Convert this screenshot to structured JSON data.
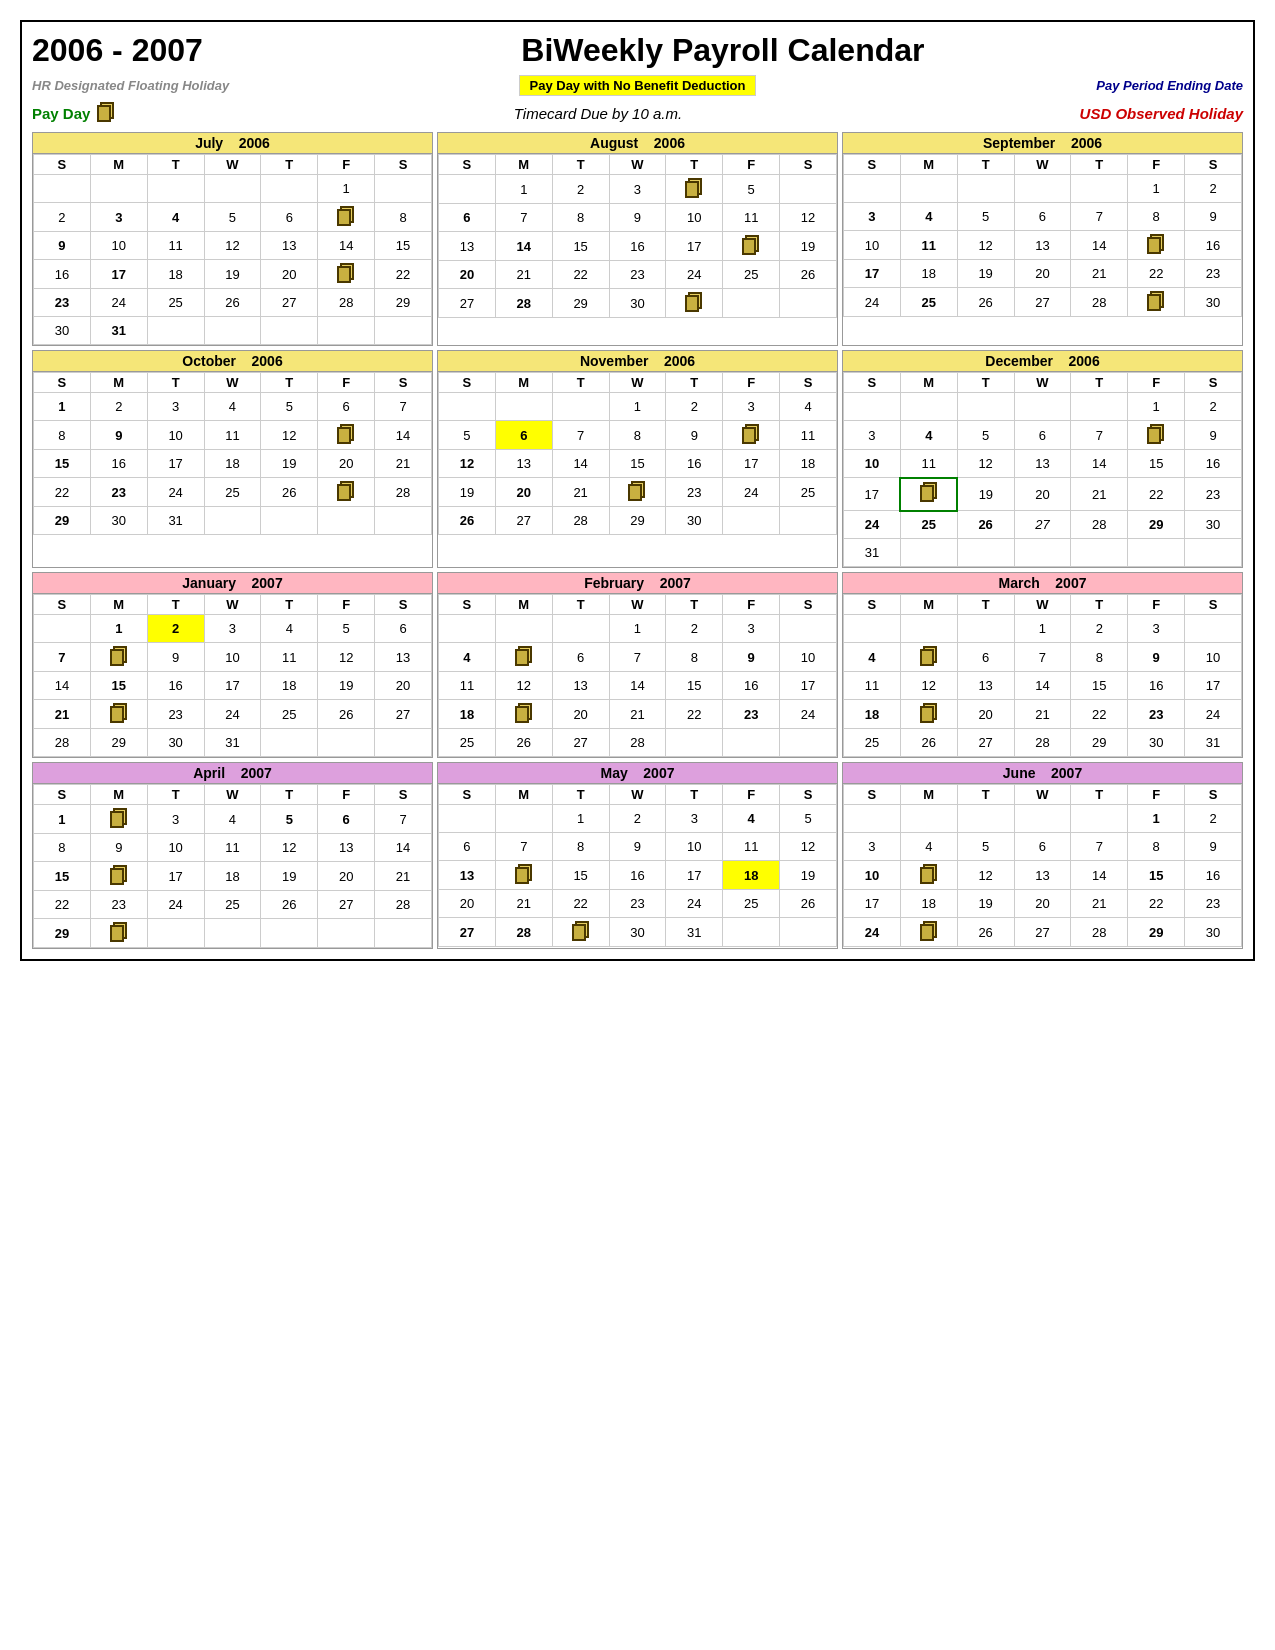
{
  "title": {
    "years": "2006 - 2007",
    "calendar_title": "BiWeekly Payroll Calendar"
  },
  "legend": {
    "floating_holiday": "HR Designated Floating Holiday",
    "pay_no_benefit": "Pay Day with No Benefit Deduction",
    "period_ending": "Pay Period Ending Date",
    "pay_day": "Pay Day",
    "timecard_due": "Timecard Due by 10 a.m.",
    "usd_holiday": "USD Observed Holiday"
  },
  "months": [
    {
      "name": "July",
      "year": "2006",
      "theme": "yellow",
      "days": [
        {
          "row": 0,
          "cells": [
            "",
            "",
            "",
            "",
            "",
            "1",
            ""
          ]
        },
        {
          "row": 1,
          "cells": [
            "2",
            "3",
            "4",
            "5",
            "6",
            "TC",
            "8"
          ]
        },
        {
          "row": 2,
          "cells": [
            "9",
            "10",
            "11",
            "12",
            "13",
            "14",
            "15"
          ]
        },
        {
          "row": 3,
          "cells": [
            "16",
            "17",
            "18",
            "19",
            "20",
            "TC",
            "22"
          ]
        },
        {
          "row": 4,
          "cells": [
            "23",
            "24",
            "25",
            "26",
            "27",
            "28",
            "29"
          ]
        },
        {
          "row": 5,
          "cells": [
            "30",
            "31",
            "",
            "",
            "",
            "",
            ""
          ]
        }
      ],
      "special": {
        "3": "td-green td-bold",
        "4": "td-red td-bold",
        "17": "td-green td-bold",
        "31": "td-green td-bold"
      },
      "tc_cells": [
        "F4",
        "F16",
        "F22"
      ]
    },
    {
      "name": "August",
      "year": "2006",
      "theme": "yellow",
      "days": [
        {
          "row": 0,
          "cells": [
            "",
            "1",
            "2",
            "3",
            "TC",
            "5",
            ""
          ]
        },
        {
          "row": 1,
          "cells": [
            "6",
            "7",
            "8",
            "9",
            "10",
            "11",
            "12"
          ]
        },
        {
          "row": 2,
          "cells": [
            "13",
            "14",
            "15",
            "16",
            "17",
            "TC",
            "19"
          ]
        },
        {
          "row": 3,
          "cells": [
            "20",
            "21",
            "22",
            "23",
            "24",
            "25",
            "26"
          ]
        },
        {
          "row": 4,
          "cells": [
            "27",
            "28",
            "29",
            "30",
            "TC",
            "",
            ""
          ]
        }
      ],
      "special": {
        "6": "td-blue td-bold",
        "14": "td-green td-bold",
        "20": "td-green td-bold",
        "28": "td-green td-bold"
      }
    },
    {
      "name": "September",
      "year": "2006",
      "theme": "yellow",
      "days": [
        {
          "row": 0,
          "cells": [
            "",
            "",
            "",
            "",
            "",
            "1",
            "2"
          ]
        },
        {
          "row": 1,
          "cells": [
            "3",
            "4",
            "5",
            "6",
            "7",
            "8",
            "9"
          ]
        },
        {
          "row": 2,
          "cells": [
            "10",
            "11",
            "12",
            "13",
            "14",
            "TC",
            "16"
          ]
        },
        {
          "row": 3,
          "cells": [
            "17",
            "18",
            "19",
            "20",
            "21",
            "22",
            "23"
          ]
        },
        {
          "row": 4,
          "cells": [
            "24",
            "25",
            "26",
            "27",
            "28",
            "TC",
            "30"
          ]
        }
      ],
      "special": {
        "3": "td-blue td-bold",
        "4": "td-orange td-bold",
        "11": "td-green td-bold",
        "17": "td-blue td-bold",
        "25": "td-green td-bold"
      }
    },
    {
      "name": "October",
      "year": "2006",
      "theme": "yellow",
      "days": [
        {
          "row": 0,
          "cells": [
            "1",
            "2",
            "3",
            "4",
            "5",
            "6",
            "7"
          ]
        },
        {
          "row": 1,
          "cells": [
            "8",
            "9",
            "10",
            "11",
            "12",
            "TC",
            "14"
          ]
        },
        {
          "row": 2,
          "cells": [
            "15",
            "16",
            "17",
            "18",
            "19",
            "20",
            "21"
          ]
        },
        {
          "row": 3,
          "cells": [
            "22",
            "23",
            "24",
            "25",
            "26",
            "TC",
            "28"
          ]
        },
        {
          "row": 4,
          "cells": [
            "29",
            "30",
            "31",
            "",
            "",
            "",
            ""
          ]
        }
      ],
      "special": {
        "1": "td-blue td-bold",
        "9": "td-green td-bold",
        "15": "td-blue td-bold",
        "23": "td-green td-bold",
        "29": "td-blue td-bold"
      }
    },
    {
      "name": "November",
      "year": "2006",
      "theme": "yellow",
      "days": [
        {
          "row": 0,
          "cells": [
            "",
            "",
            "",
            "1",
            "2",
            "3",
            "4"
          ]
        },
        {
          "row": 1,
          "cells": [
            "5",
            "6",
            "7",
            "8",
            "9",
            "TC",
            "11"
          ]
        },
        {
          "row": 2,
          "cells": [
            "12",
            "13",
            "14",
            "15",
            "16",
            "17",
            "18"
          ]
        },
        {
          "row": 3,
          "cells": [
            "19",
            "20",
            "21",
            "TC",
            "23",
            "24",
            "25"
          ]
        },
        {
          "row": 4,
          "cells": [
            "26",
            "27",
            "28",
            "29",
            "30",
            "",
            ""
          ]
        }
      ],
      "special": {
        "6": "td-yellow-bg",
        "12": "td-blue td-bold",
        "20": "td-green td-bold",
        "26": "td-blue td-bold"
      }
    },
    {
      "name": "December",
      "year": "2006",
      "theme": "yellow",
      "days": [
        {
          "row": 0,
          "cells": [
            "",
            "",
            "",
            "",
            "",
            "1",
            "2"
          ]
        },
        {
          "row": 1,
          "cells": [
            "3",
            "4",
            "5",
            "6",
            "7",
            "TC",
            "9"
          ]
        },
        {
          "row": 2,
          "cells": [
            "10",
            "11",
            "12",
            "13",
            "14",
            "15",
            "16"
          ]
        },
        {
          "row": 3,
          "cells": [
            "17",
            "TC",
            "19",
            "20",
            "21",
            "22",
            "23"
          ]
        },
        {
          "row": 4,
          "cells": [
            "24",
            "25",
            "26",
            "27",
            "28",
            "29",
            "30"
          ]
        },
        {
          "row": 5,
          "cells": [
            "31",
            "",
            "",
            "",
            "",
            "",
            ""
          ]
        }
      ],
      "special": {
        "4": "td-orange td-bold",
        "10": "td-blue td-bold",
        "TC_M17": "stacked",
        "24": "td-blue td-bold",
        "25": "td-red td-bold",
        "26": "td-red td-bold",
        "27": "td-purple td-italic",
        "29": "td-red td-bold"
      }
    },
    {
      "name": "January",
      "year": "2007",
      "theme": "pink",
      "days": [
        {
          "row": 0,
          "cells": [
            "",
            "1",
            "2",
            "3",
            "4",
            "5",
            "6"
          ]
        },
        {
          "row": 1,
          "cells": [
            "7",
            "TC",
            "9",
            "10",
            "11",
            "12",
            "13"
          ]
        },
        {
          "row": 2,
          "cells": [
            "14",
            "15",
            "16",
            "17",
            "18",
            "19",
            "20"
          ]
        },
        {
          "row": 3,
          "cells": [
            "21",
            "TC",
            "23",
            "24",
            "25",
            "26",
            "27"
          ]
        },
        {
          "row": 4,
          "cells": [
            "28",
            "29",
            "30",
            "31",
            "",
            "",
            ""
          ]
        }
      ],
      "special": {
        "1": "td-blue td-bold",
        "2": "td-yellow-bg td-bold",
        "7": "td-blue td-bold",
        "15": "td-red td-bold",
        "21": "td-blue td-bold"
      }
    },
    {
      "name": "February",
      "year": "2007",
      "theme": "pink",
      "days": [
        {
          "row": 0,
          "cells": [
            "",
            "",
            "",
            "1",
            "2",
            "3",
            ""
          ]
        },
        {
          "row": 1,
          "cells": [
            "4",
            "TC",
            "6",
            "7",
            "8",
            "9",
            "10"
          ]
        },
        {
          "row": 2,
          "cells": [
            "11",
            "12",
            "13",
            "14",
            "15",
            "16",
            "17"
          ]
        },
        {
          "row": 3,
          "cells": [
            "18",
            "TC",
            "20",
            "21",
            "22",
            "23",
            "24"
          ]
        },
        {
          "row": 4,
          "cells": [
            "25",
            "26",
            "27",
            "28",
            "",
            "",
            ""
          ]
        }
      ],
      "special": {
        "4": "td-blue td-bold",
        "9": "td-green td-bold",
        "18": "td-blue td-bold",
        "23": "td-green td-bold"
      }
    },
    {
      "name": "March",
      "year": "2007",
      "theme": "pink",
      "days": [
        {
          "row": 0,
          "cells": [
            "",
            "",
            "",
            "1",
            "2",
            "3",
            ""
          ]
        },
        {
          "row": 1,
          "cells": [
            "4",
            "TC",
            "6",
            "7",
            "8",
            "9",
            "10"
          ]
        },
        {
          "row": 2,
          "cells": [
            "11",
            "12",
            "13",
            "14",
            "15",
            "16",
            "17"
          ]
        },
        {
          "row": 3,
          "cells": [
            "18",
            "TC",
            "20",
            "21",
            "22",
            "23",
            "24"
          ]
        },
        {
          "row": 4,
          "cells": [
            "25",
            "26",
            "27",
            "28",
            "29",
            "30",
            "31"
          ]
        }
      ],
      "special": {
        "4": "td-blue td-bold",
        "9": "td-green td-bold",
        "18": "td-blue td-bold",
        "23": "td-green td-bold"
      }
    },
    {
      "name": "April",
      "year": "2007",
      "theme": "lilac",
      "days": [
        {
          "row": 0,
          "cells": [
            "1",
            "TC",
            "3",
            "4",
            "5",
            "6",
            "7"
          ]
        },
        {
          "row": 1,
          "cells": [
            "8",
            "9",
            "10",
            "11",
            "12",
            "13",
            "14"
          ]
        },
        {
          "row": 2,
          "cells": [
            "15",
            "TC",
            "17",
            "18",
            "19",
            "20",
            "21"
          ]
        },
        {
          "row": 3,
          "cells": [
            "22",
            "23",
            "24",
            "25",
            "26",
            "27",
            "28"
          ]
        },
        {
          "row": 4,
          "cells": [
            "29",
            "TC",
            "",
            "",
            "",
            "",
            ""
          ]
        }
      ],
      "special": {
        "1": "td-blue td-bold",
        "5": "td-green td-bold",
        "6": "td-red td-bold",
        "15": "td-blue td-bold",
        "29": "td-blue td-bold"
      }
    },
    {
      "name": "May",
      "year": "2007",
      "theme": "lilac",
      "days": [
        {
          "row": 0,
          "cells": [
            "",
            "",
            "1",
            "2",
            "3",
            "4",
            "5"
          ]
        },
        {
          "row": 1,
          "cells": [
            "6",
            "7",
            "8",
            "9",
            "10",
            "11",
            "12"
          ]
        },
        {
          "row": 2,
          "cells": [
            "13",
            "TC",
            "15",
            "16",
            "17",
            "18",
            "19"
          ]
        },
        {
          "row": 3,
          "cells": [
            "20",
            "21",
            "22",
            "23",
            "24",
            "25",
            "26"
          ]
        },
        {
          "row": 4,
          "cells": [
            "27",
            "28",
            "TC",
            "30",
            "31",
            "",
            ""
          ]
        }
      ],
      "special": {
        "4": "td-green td-bold",
        "13": "td-blue td-bold",
        "18": "td-yellow-bg td-bold",
        "27": "td-blue td-bold",
        "28": "td-red td-bold"
      }
    },
    {
      "name": "June",
      "year": "2007",
      "theme": "lilac",
      "days": [
        {
          "row": 0,
          "cells": [
            "",
            "",
            "",
            "",
            "",
            "1",
            "2"
          ]
        },
        {
          "row": 1,
          "cells": [
            "3",
            "4",
            "5",
            "6",
            "7",
            "8",
            "9"
          ]
        },
        {
          "row": 2,
          "cells": [
            "10",
            "TC",
            "12",
            "13",
            "14",
            "15",
            "16"
          ]
        },
        {
          "row": 3,
          "cells": [
            "17",
            "18",
            "19",
            "20",
            "21",
            "22",
            "23"
          ]
        },
        {
          "row": 4,
          "cells": [
            "24",
            "TC",
            "26",
            "27",
            "28",
            "29",
            "30"
          ]
        }
      ],
      "special": {
        "1": "td-green td-bold",
        "10": "td-blue td-bold",
        "15": "td-green td-bold",
        "24": "td-blue td-bold",
        "29": "td-green td-bold"
      }
    }
  ]
}
